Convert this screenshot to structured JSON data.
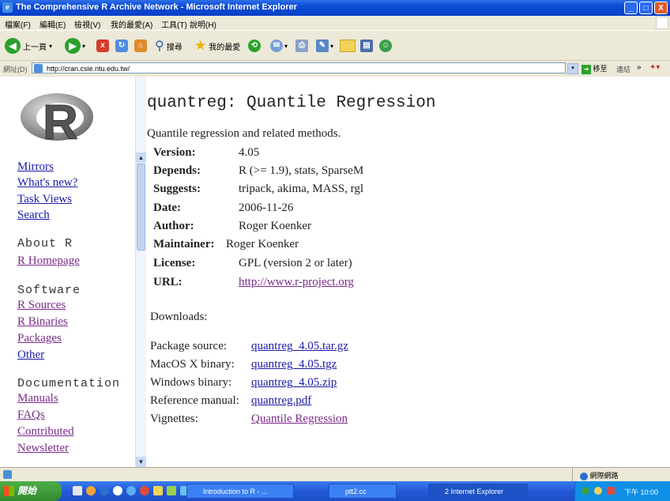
{
  "window": {
    "title": "The Comprehensive R Archive Network - Microsoft Internet Explorer",
    "buttons": {
      "minimize": "_",
      "maximize": "□",
      "close": "X"
    }
  },
  "menubar": [
    "檔案(F)",
    "編輯(E)",
    "檢視(V)",
    "我的最愛(A)",
    "工具(T)",
    "說明(H)"
  ],
  "toolbar": {
    "back_label": "上一頁",
    "search_label": "搜尋",
    "favorites_label": "我的最愛"
  },
  "addressbar": {
    "label": "網址(D)",
    "url": "http://cran.csie.ntu.edu.tw/",
    "go_label": "移至",
    "links_label": "連結"
  },
  "sidebar": {
    "nav": [
      "Mirrors",
      "What's new?",
      "Task Views",
      "Search"
    ],
    "about_heading": "About R",
    "about_links": [
      "R Homepage"
    ],
    "software_heading": "Software",
    "software_links": [
      "R Sources",
      "R Binaries",
      "Packages",
      "Other"
    ],
    "documentation_heading": "Documentation",
    "documentation_links": [
      "Manuals",
      "FAQs",
      "Contributed",
      "Newsletter"
    ]
  },
  "main": {
    "title": "quantreg: Quantile Regression",
    "description": "Quantile regression and related methods.",
    "fields": [
      {
        "key": "Version:",
        "value": "4.05"
      },
      {
        "key": "Depends:",
        "value": "R (>= 1.9), stats, SparseM"
      },
      {
        "key": "Suggests:",
        "value": "tripack, akima, MASS, rgl"
      },
      {
        "key": "Date:",
        "value": "2006-11-26"
      },
      {
        "key": "Author:",
        "value": "Roger Koenker"
      },
      {
        "key": "Maintainer:",
        "value": "Roger Koenker"
      },
      {
        "key": "License:",
        "value": "GPL (version 2 or later)"
      },
      {
        "key": "URL:",
        "value": "http://www.r-project.org"
      }
    ],
    "downloads_heading": "Downloads:",
    "downloads": [
      {
        "key": "Package source:",
        "value": "quantreg_4.05.tar.gz"
      },
      {
        "key": "MacOS X binary:",
        "value": "quantreg_4.05.tgz"
      },
      {
        "key": "Windows binary:",
        "value": "quantreg_4.05.zip"
      },
      {
        "key": "Reference manual:",
        "value": "quantreg.pdf"
      },
      {
        "key": "Vignettes:",
        "value": "Quantile Regression"
      }
    ]
  },
  "statusbar": {
    "zone": "網際網路"
  },
  "taskbar": {
    "start_label": "開始",
    "tasks": [
      "Introduction to R - ...",
      "ptt2.cc",
      "2 Internet Explorer"
    ],
    "clock": "下午 10:00"
  }
}
